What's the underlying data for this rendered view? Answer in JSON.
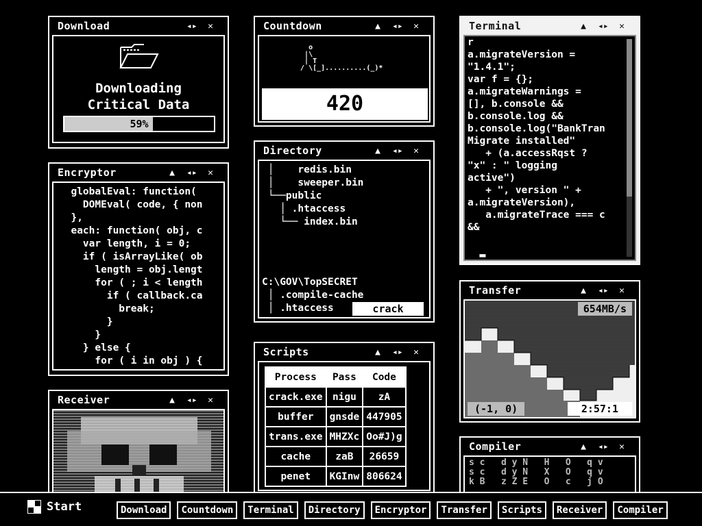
{
  "windows": {
    "download": {
      "title": "Download",
      "line1": "Downloading",
      "line2": "Critical Data",
      "progress_label": "59%",
      "progress": 0.59
    },
    "countdown": {
      "title": "Countdown",
      "value": "420"
    },
    "terminal": {
      "title": "Terminal",
      "lines": "r\na.migrateVersion =\n\"1.4.1\";\nvar f = {};\na.migrateWarnings =\n[], b.console &&\nb.console.log &&\nb.console.log(\"BankTran\nMigrate installed\"\n   + (a.accessRqst ?\n\"x\" : \" logging\nactive\")\n   + \", version \" +\na.migrateVersion),\n   a.migrateTrace === c\n&&\n\n  ▂"
    },
    "encryptor": {
      "title": "Encryptor",
      "code": "  globalEval: function(\n    DOMEval( code, { non\n  },\n  each: function( obj, c\n    var length, i = 0;\n    if ( isArrayLike( ob\n      length = obj.lengt\n      for ( ; i < length\n        if ( callback.ca\n          break;\n        }\n      }\n    } else {\n      for ( i in obj ) {"
    },
    "directory": {
      "title": "Directory",
      "tree": " │    redis.bin\n │    sweeper.bin\n └──public\n   │ .htaccess\n   └── index.bin",
      "path_tree": "C:\\GOV\\TopSECRET\n │ .compile-cache\n │ .htaccess",
      "crack_label": "crack"
    },
    "scripts": {
      "title": "Scripts",
      "headers": [
        "Process",
        "Pass",
        "Code"
      ],
      "rows": [
        [
          "crack.exe",
          "nigu",
          "zA"
        ],
        [
          "buffer",
          "gnsde",
          "447905"
        ],
        [
          "trans.exe",
          "MHZXc",
          "Oo#J)g"
        ],
        [
          "cache",
          "zaB",
          "26659"
        ],
        [
          "penet",
          "KGInw",
          "806624"
        ]
      ]
    },
    "transfer": {
      "title": "Transfer",
      "speed": "654MB/s",
      "coord": "(-1, 0)",
      "timer": "2:57:1"
    },
    "receiver": {
      "title": "Receiver"
    },
    "compiler": {
      "title": "Compiler",
      "grid": "s c   d y N   H   O   q v\ns c   d y N   X   O   q v\nk B   z Z E   O   c   j O"
    }
  },
  "taskbar": {
    "start_label": "Start",
    "tasks": [
      "Download",
      "Countdown",
      "Terminal",
      "Directory",
      "Encryptor",
      "Transfer",
      "Scripts",
      "Receiver",
      "Compiler"
    ]
  },
  "icons": {
    "move": "move-icon",
    "close": "close-icon",
    "maximize": "maximize-icon"
  }
}
